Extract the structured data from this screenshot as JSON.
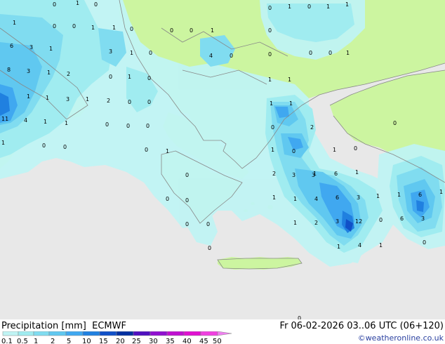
{
  "map": {
    "labels": [
      {
        "t": "0"
      },
      {
        "t": "1"
      },
      {
        "t": "0"
      },
      {
        "t": "1"
      },
      {
        "t": "0"
      },
      {
        "t": "1"
      },
      {
        "t": "0"
      },
      {
        "t": "1"
      },
      {
        "t": "0"
      },
      {
        "t": "1"
      },
      {
        "t": "0"
      },
      {
        "t": "0"
      },
      {
        "t": "0"
      },
      {
        "t": "1"
      },
      {
        "t": "0"
      },
      {
        "t": "1"
      },
      {
        "t": "1"
      },
      {
        "t": "0"
      },
      {
        "t": "6"
      },
      {
        "t": "3"
      },
      {
        "t": "1"
      },
      {
        "t": "3"
      },
      {
        "t": "1"
      },
      {
        "t": "0"
      },
      {
        "t": "4"
      },
      {
        "t": "0"
      },
      {
        "t": "0"
      },
      {
        "t": "0"
      },
      {
        "t": "0"
      },
      {
        "t": "1"
      },
      {
        "t": "8"
      },
      {
        "t": "3"
      },
      {
        "t": "1"
      },
      {
        "t": "2"
      },
      {
        "t": "0"
      },
      {
        "t": "1"
      },
      {
        "t": "0"
      },
      {
        "t": "1"
      },
      {
        "t": "1"
      },
      {
        "t": "1"
      },
      {
        "t": "1"
      },
      {
        "t": "3"
      },
      {
        "t": "1"
      },
      {
        "t": "2"
      },
      {
        "t": "0"
      },
      {
        "t": "0"
      },
      {
        "t": "1"
      },
      {
        "t": "1"
      },
      {
        "t": "11"
      },
      {
        "t": "4"
      },
      {
        "t": "1"
      },
      {
        "t": "1"
      },
      {
        "t": "0"
      },
      {
        "t": "0"
      },
      {
        "t": "0"
      },
      {
        "t": "0"
      },
      {
        "t": "2"
      },
      {
        "t": "0"
      },
      {
        "t": "1"
      },
      {
        "t": "0"
      },
      {
        "t": "0"
      },
      {
        "t": "1"
      },
      {
        "t": "0"
      },
      {
        "t": "1"
      },
      {
        "t": "0"
      },
      {
        "t": "1"
      },
      {
        "t": "0"
      },
      {
        "t": "0"
      },
      {
        "t": "2"
      },
      {
        "t": "3"
      },
      {
        "t": "1"
      },
      {
        "t": "1"
      },
      {
        "t": "0"
      },
      {
        "t": "0"
      },
      {
        "t": "3"
      },
      {
        "t": "6"
      },
      {
        "t": "1"
      },
      {
        "t": "1"
      },
      {
        "t": "0"
      },
      {
        "t": "1"
      },
      {
        "t": "6"
      },
      {
        "t": "1"
      },
      {
        "t": "1"
      },
      {
        "t": "4"
      },
      {
        "t": "6"
      },
      {
        "t": "3"
      },
      {
        "t": "6"
      },
      {
        "t": "3"
      },
      {
        "t": "1"
      },
      {
        "t": "0"
      },
      {
        "t": "2"
      },
      {
        "t": "3"
      },
      {
        "t": "12"
      },
      {
        "t": "0"
      },
      {
        "t": "1"
      },
      {
        "t": "4"
      },
      {
        "t": "1"
      },
      {
        "t": "0"
      },
      {
        "t": "0"
      },
      {
        "t": "0"
      }
    ]
  },
  "footer": {
    "title": "Precipitation [mm]  ECMWF",
    "valid": "Fr 06-02-2026 03..06 UTC (06+120)",
    "copyright": "©weatheronline.co.uk",
    "scale_labels": [
      "0.1",
      "0.5",
      "1",
      "2",
      "5",
      "10",
      "15",
      "20",
      "25",
      "30",
      "35",
      "40",
      "45",
      "50"
    ]
  },
  "colors": {
    "sea": "#e8e8e8",
    "land": "#ccf5a0",
    "p01": "#c0f4f4",
    "p05": "#a0ecf0",
    "p1": "#80dcf0",
    "p2": "#60c8f0",
    "p5": "#40a8f0",
    "p10": "#2080e0",
    "p15": "#1050c8",
    "p20": "#0030a0",
    "p25": "#5010c0",
    "p30": "#9010d0",
    "p35": "#c010d0",
    "p40": "#e010d0",
    "p45": "#f040e0",
    "p50": "#f080f0"
  }
}
